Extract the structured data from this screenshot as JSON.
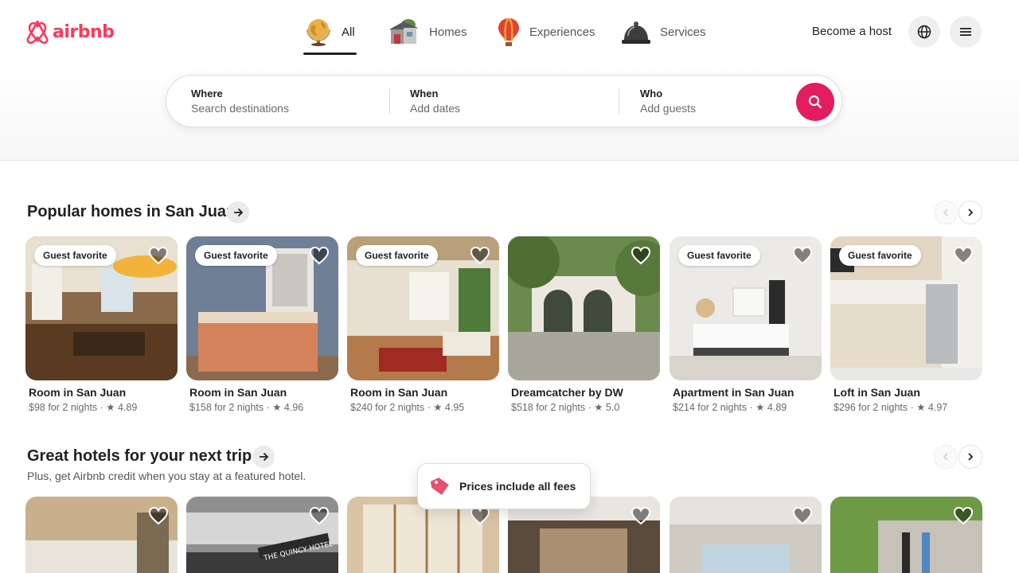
{
  "brand": {
    "name": "airbnb",
    "color": "#ff385c"
  },
  "categories": [
    {
      "label": "All",
      "icon": "globe-icon",
      "active": true
    },
    {
      "label": "Homes",
      "icon": "house-icon",
      "active": false
    },
    {
      "label": "Experiences",
      "icon": "hot-air-balloon-icon",
      "active": false
    },
    {
      "label": "Services",
      "icon": "service-bell-icon",
      "active": false
    }
  ],
  "header": {
    "become_host": "Become a host",
    "language_icon": "globe-icon",
    "menu_icon": "hamburger-menu-icon"
  },
  "search": {
    "where": {
      "label": "Where",
      "placeholder": "Search destinations"
    },
    "when": {
      "label": "When",
      "placeholder": "Add dates"
    },
    "who": {
      "label": "Who",
      "placeholder": "Add guests"
    },
    "button_icon": "search-icon",
    "button_color": "#e31c5f"
  },
  "section1": {
    "title": "Popular homes in San Juan",
    "listings": [
      {
        "badge": "Guest favorite",
        "title": "Room in San Juan",
        "meta": "$98 for 2 nights · ★ 4.89"
      },
      {
        "badge": "Guest favorite",
        "title": "Room in San Juan",
        "meta": "$158 for 2 nights · ★ 4.96"
      },
      {
        "badge": "Guest favorite",
        "title": "Room in San Juan",
        "meta": "$240 for 2 nights · ★ 4.95"
      },
      {
        "badge": "",
        "title": "Dreamcatcher by DW",
        "meta": "$518 for 2 nights · ★ 5.0"
      },
      {
        "badge": "Guest favorite",
        "title": "Apartment in San Juan",
        "meta": "$214 for 2 nights · ★ 4.89"
      },
      {
        "badge": "Guest favorite",
        "title": "Loft in San Juan",
        "meta": "$296 for 2 nights · ★ 4.97"
      }
    ]
  },
  "section2": {
    "title": "Great hotels for your next trip",
    "subtitle": "Plus, get Airbnb credit when you stay at a featured hotel.",
    "hotel_sign": "THE QUINCY HOTEL"
  },
  "toast": {
    "text": "Prices include all fees",
    "icon": "price-tag-icon"
  }
}
